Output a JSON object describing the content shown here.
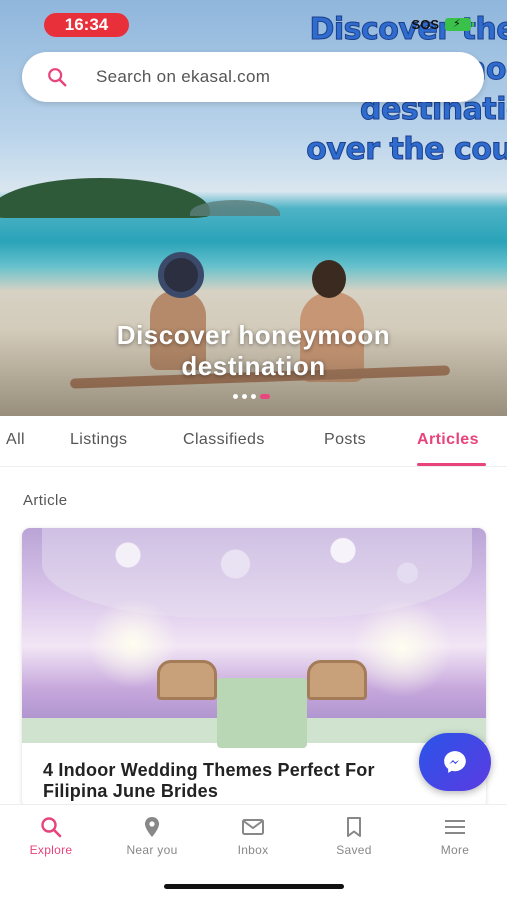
{
  "status_bar": {
    "time": "16:34",
    "carrier": "SOS"
  },
  "hero": {
    "background_text": [
      "Discover the b",
      "honeymoon",
      "destination",
      "over the count"
    ],
    "caption_line1": "Discover honeymoon",
    "caption_line2": "destination",
    "carousel_dots": 4,
    "active_dot_index": 3
  },
  "search": {
    "placeholder": "Search on ekasal.com",
    "icon": "search-icon"
  },
  "tabs": [
    {
      "label": "All",
      "active": false
    },
    {
      "label": "Listings",
      "active": false
    },
    {
      "label": "Classifieds",
      "active": false
    },
    {
      "label": "Posts",
      "active": false
    },
    {
      "label": "Articles",
      "active": true
    }
  ],
  "section": {
    "label": "Article"
  },
  "article": {
    "title": "4 Indoor Wedding Themes Perfect For Filipina June Brides"
  },
  "fab": {
    "icon": "messenger-icon"
  },
  "bottom_nav": [
    {
      "label": "Explore",
      "icon": "search-icon",
      "active": true
    },
    {
      "label": "Near you",
      "icon": "location-pin-icon",
      "active": false
    },
    {
      "label": "Inbox",
      "icon": "envelope-icon",
      "active": false
    },
    {
      "label": "Saved",
      "icon": "bookmark-icon",
      "active": false
    },
    {
      "label": "More",
      "icon": "menu-icon",
      "active": false
    }
  ],
  "colors": {
    "accent": "#e8437b",
    "status_pill": "#e8303b",
    "messenger": "#2a54e8"
  }
}
